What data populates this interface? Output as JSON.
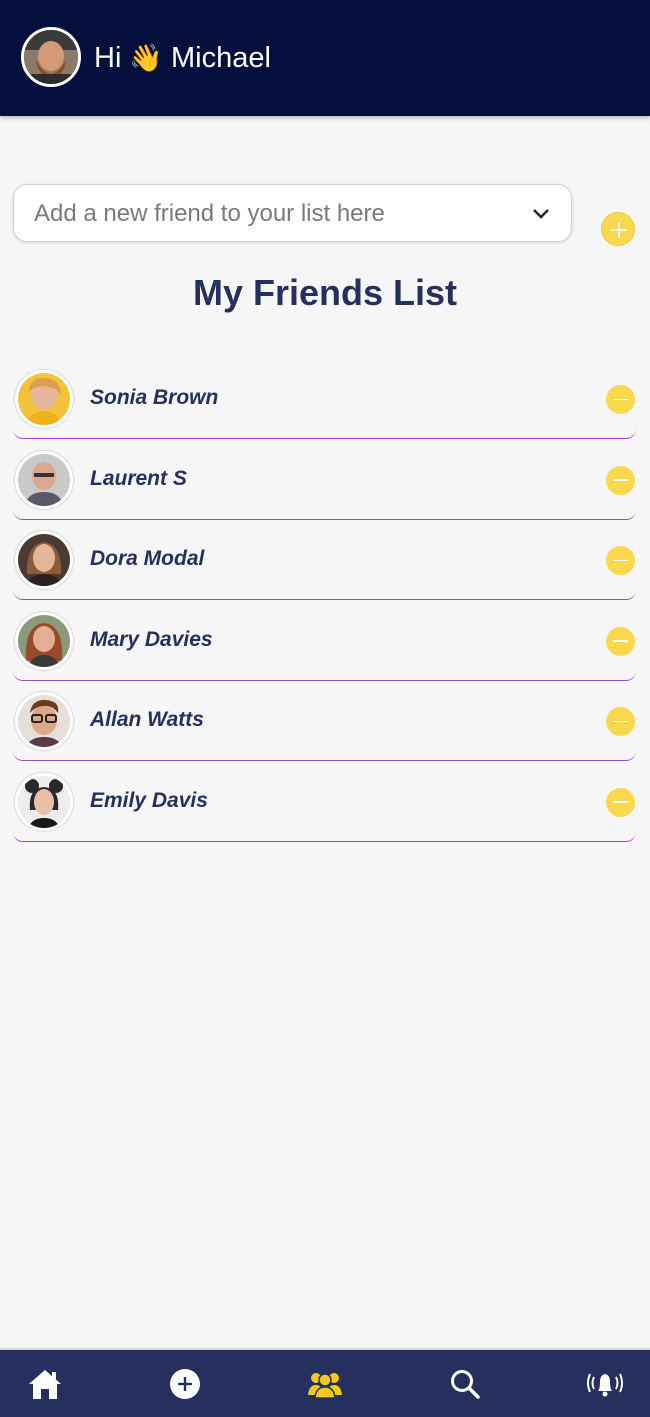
{
  "header": {
    "greeting_prefix": "Hi",
    "wave_emoji": "👋",
    "user_name": "Michael"
  },
  "add_friend": {
    "placeholder": "Add a new friend to your list here"
  },
  "title": "My Friends List",
  "friends": [
    {
      "name": "Sonia Brown"
    },
    {
      "name": "Laurent S"
    },
    {
      "name": "Dora Modal"
    },
    {
      "name": "Mary Davies"
    },
    {
      "name": "Allan Watts"
    },
    {
      "name": "Emily Davis"
    }
  ],
  "nav": [
    {
      "icon": "home-icon"
    },
    {
      "icon": "add-circle-icon"
    },
    {
      "icon": "friends-icon",
      "active": true
    },
    {
      "icon": "search-icon"
    },
    {
      "icon": "notification-bell-icon"
    }
  ],
  "colors": {
    "header_bg": "#040f3d",
    "navbar_bg": "#26305e",
    "accent_yellow": "#fad84e",
    "title_text": "#26305e",
    "divider_purple": "#a144cc"
  }
}
